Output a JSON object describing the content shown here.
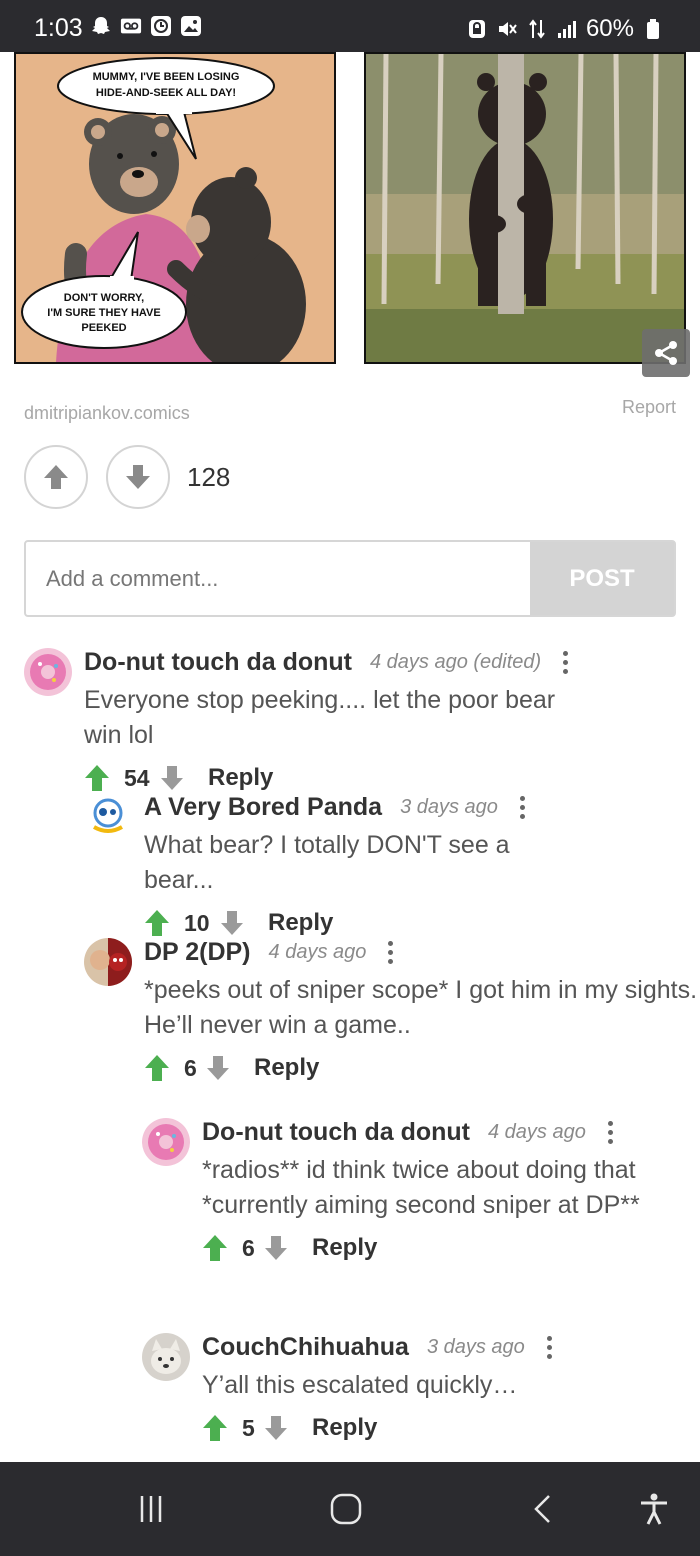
{
  "status_bar": {
    "time": "1:03",
    "battery": "60%"
  },
  "comic": {
    "bubble_top": "Mummy, I've been losing hide-and-seek all day!",
    "bubble_bottom": "Don't worry, I'm sure they have peeked"
  },
  "post": {
    "source": "dmitripiankov.comics",
    "report_label": "Report",
    "score": "128"
  },
  "comment_form": {
    "placeholder": "Add a comment...",
    "post_label": "POST"
  },
  "comments": [
    {
      "author": "Do-nut touch da donut",
      "time": "4 days ago (edited)",
      "text": "Everyone stop peeking.... let the poor bear win lol",
      "votes": "54",
      "reply_label": "Reply"
    },
    {
      "author": "A Very Bored Panda",
      "time": "3 days ago",
      "text": "What bear? I totally DON'T see a bear...",
      "votes": "10",
      "reply_label": "Reply"
    },
    {
      "author": "DP 2(DP)",
      "time": "4 days ago",
      "text": "*peeks out of sniper scope* I got him in my sights. He’ll never win a game..",
      "votes": "6",
      "reply_label": "Reply"
    },
    {
      "author": "Do-nut touch da donut",
      "time": "4 days ago",
      "text": "*radios** id think twice about doing that *currently aiming second sniper at DP**",
      "votes": "6",
      "reply_label": "Reply"
    },
    {
      "author": "CouchChihuahua",
      "time": "3 days ago",
      "text": "Y’all this escalated quickly…",
      "votes": "5",
      "reply_label": "Reply"
    }
  ],
  "colors": {
    "upvote_green": "#4caf50",
    "status_bar_bg": "#2b2b2f",
    "post_button_bg": "#d4d4d4"
  },
  "icons": {
    "share": "share-icon",
    "upvote": "arrow-up-icon",
    "downvote": "arrow-down-icon",
    "more": "kebab-menu-icon"
  }
}
